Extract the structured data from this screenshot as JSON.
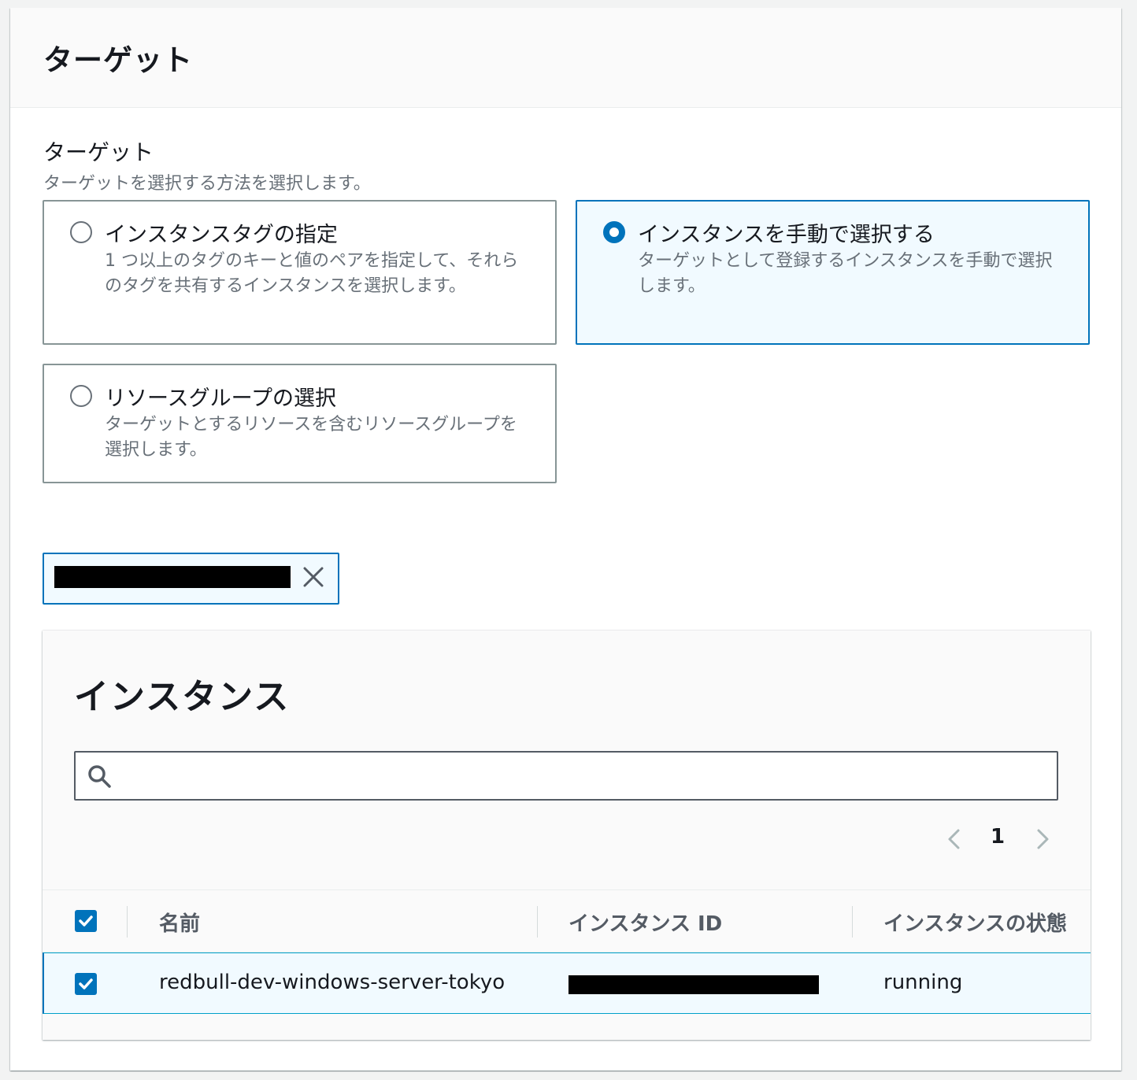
{
  "panel": {
    "title": "ターゲット"
  },
  "targets": {
    "label": "ターゲット",
    "description": "ターゲットを選択する方法を選択します。",
    "options": [
      {
        "title": "インスタンスタグの指定",
        "description": "1 つ以上のタグのキーと値のペアを指定して、それらのタグを共有するインスタンスを選択します。",
        "selected": false
      },
      {
        "title": "インスタンスを手動で選択する",
        "description": "ターゲットとして登録するインスタンスを手動で選択します。",
        "selected": true
      },
      {
        "title": "リソースグループの選択",
        "description": "ターゲットとするリソースを含むリソースグループを選択します。",
        "selected": false
      }
    ]
  },
  "instances": {
    "title": "インスタンス",
    "search_placeholder": "",
    "pagination": {
      "current_page": "1"
    },
    "columns": [
      "名前",
      "インスタンス ID",
      "インスタンスの状態"
    ],
    "rows": [
      {
        "name": "redbull-dev-windows-server-tokyo",
        "state": "running",
        "selected": true
      }
    ]
  },
  "colors": {
    "accent": "#0073bb",
    "selected_bg": "#f1faff",
    "muted_text": "#687078"
  }
}
